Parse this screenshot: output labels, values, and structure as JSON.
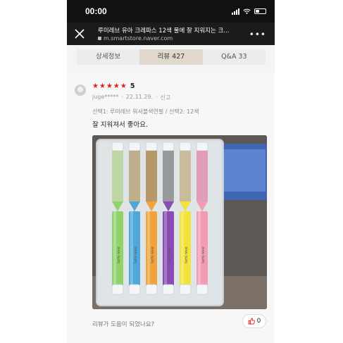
{
  "status_bar": {
    "time": "00:00"
  },
  "browser": {
    "page_title": "루미레브 유아 크레파스 12색 물에 잘 지워지는 크...",
    "domain": "m.smartstore.naver.com",
    "more_label": "•••"
  },
  "tabs": [
    {
      "label": "상세정보",
      "active": false
    },
    {
      "label": "리뷰 427",
      "active": true
    },
    {
      "label": "Q&A  33",
      "active": false
    }
  ],
  "review": {
    "stars": [
      "★",
      "★",
      "★",
      "★",
      "★"
    ],
    "rating": "5",
    "author": "juge*****",
    "date": "22.11.29.",
    "report_label": "신고",
    "separator": "·",
    "option_text": "선택1: 루미레브 워셔블색연필 / 선택2: 12색",
    "text": "잘 지워져서 좋아요.",
    "photo": {
      "crayon_colors": [
        "#8fd36a",
        "#4ea7d8",
        "#f0a33a",
        "#8b4bb5",
        "#f2e23a",
        "#f29bb5"
      ],
      "crayon_cap_colors": [
        "#b7d39a",
        "#b9a57a",
        "#b08c52",
        "#8c8c8c",
        "#c7b48c",
        "#e38fb2"
      ],
      "brand_on_crayon": "lumi reve"
    },
    "helpful_prompt": "리뷰가 도움이 되었나요?",
    "helpful_count": "0"
  },
  "colors": {
    "star_red": "#e02020",
    "tab_active_bg": "#e0d8cc",
    "status_bg": "#111111",
    "urlbar_bg": "#1c1c1c"
  }
}
